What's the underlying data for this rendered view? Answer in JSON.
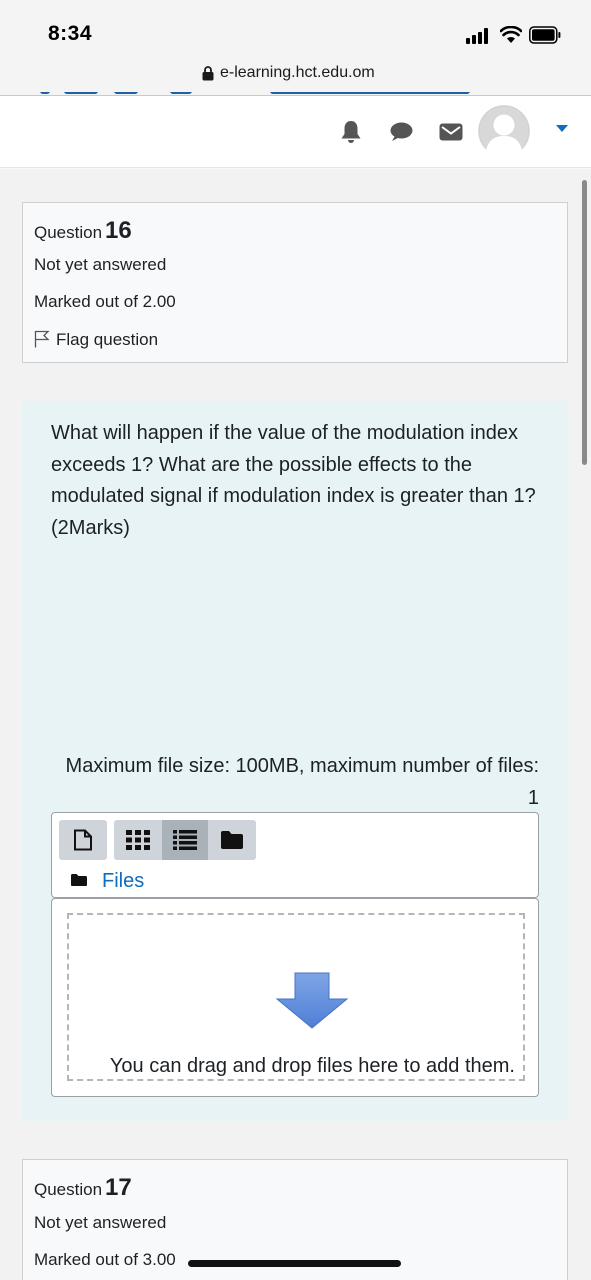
{
  "status_bar": {
    "time": "8:34"
  },
  "browser": {
    "url": "e-learning.hct.edu.om"
  },
  "navbar": {
    "icons": [
      "bell-icon",
      "chat-icon",
      "envelope-icon",
      "avatar",
      "caret-down-icon"
    ]
  },
  "question16": {
    "label": "Question",
    "number": "16",
    "status": "Not yet answered",
    "marks": "Marked out of 2.00",
    "flag": "Flag question",
    "text": "What will happen if the value of the modulation index exceeds 1? What are the possible effects to the modulated signal if modulation index is greater than 1? (2Marks)",
    "max_file_size": "Maximum file size: 100MB, maximum number of files: 1",
    "filepicker": {
      "path_label": "Files",
      "drop_text": "You can drag and drop files here to add them."
    }
  },
  "question17": {
    "label": "Question",
    "number": "17",
    "status": "Not yet answered",
    "marks": "Marked out of 3.00"
  },
  "colors": {
    "accent": "#0f6cbf",
    "content_bg": "#e7f3f5",
    "info_bg": "#f8f9fa",
    "nav_icon": "#555555"
  }
}
